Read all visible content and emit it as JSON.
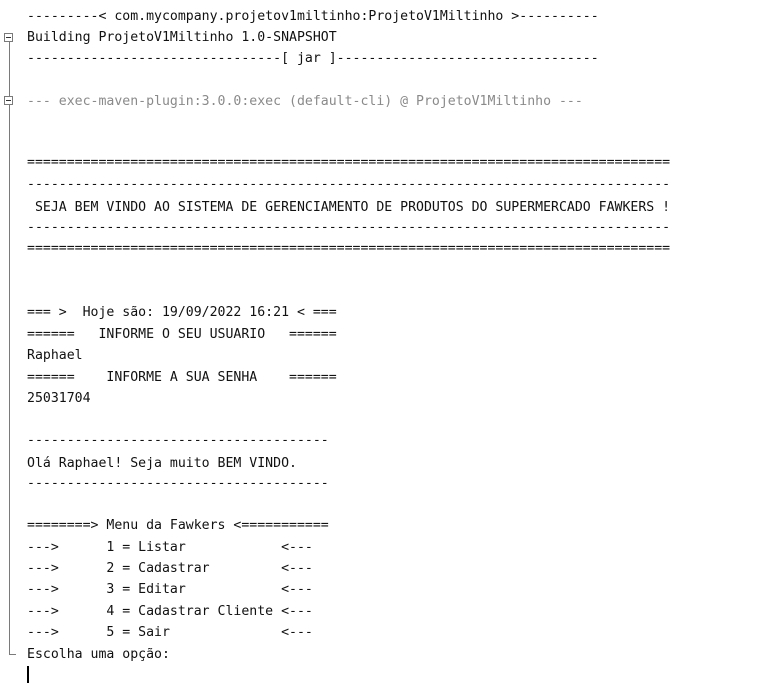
{
  "output": {
    "artifact_header": "---------< com.mycompany.projetov1miltinho:ProjetoV1Miltinho >----------",
    "building": "Building ProjetoV1Miltinho 1.0-SNAPSHOT",
    "packaging": "--------------------------------[ jar ]---------------------------------",
    "exec_plugin": "--- exec-maven-plugin:3.0.0:exec (default-cli) @ ProjetoV1Miltinho ---",
    "banner_equals_top": "=================================================================================",
    "banner_dash_top": "---------------------------------------------------------------------------------",
    "banner_welcome": " SEJA BEM VINDO AO SISTEMA DE GERENCIAMENTO DE PRODUTOS DO SUPERMERCADO FAWKERS !",
    "banner_dash_bottom": "---------------------------------------------------------------------------------",
    "banner_equals_bottom": "=================================================================================",
    "date_line": "=== >  Hoje são: 19/09/2022 16:21 < ===",
    "user_prompt": "======   INFORME O SEU USUARIO   ======",
    "user_value": "Raphael",
    "password_prompt": "======    INFORME A SUA SENHA    ======",
    "password_value": "25031704",
    "separator_top": "--------------------------------------",
    "greeting": "Olá Raphael! Seja muito BEM VINDO.",
    "separator_bottom": "--------------------------------------",
    "menu_title": "========> Menu da Fawkers <===========",
    "menu_items": [
      "--->      1 = Listar            <---",
      "--->      2 = Cadastrar         <---",
      "--->      3 = Editar            <---",
      "--->      4 = Cadastrar Cliente <---",
      "--->      5 = Sair              <---"
    ],
    "choose_prompt": "Escolha uma opção:"
  },
  "icons": {
    "fold_toggle": "collapse-minus-icon"
  },
  "colors": {
    "text": "#111111",
    "dim_text": "#8a8a8a",
    "gutter": "#7a7a7a",
    "background": "#ffffff"
  }
}
